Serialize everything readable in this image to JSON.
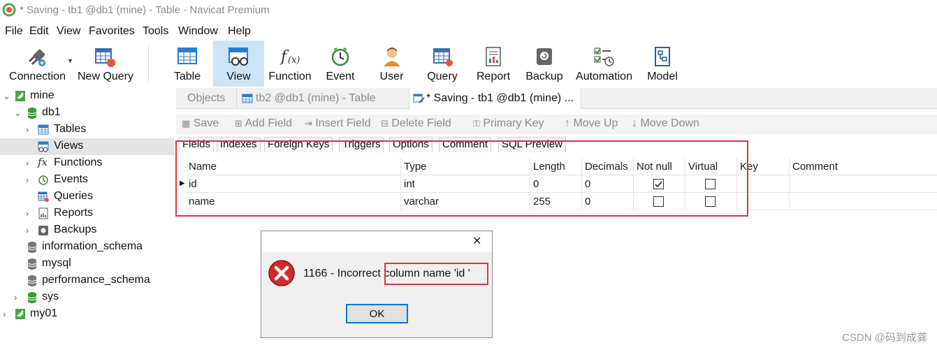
{
  "window": {
    "title": "* Saving - tb1 @db1 (mine) - Table - Navicat Premium"
  },
  "menu": [
    "File",
    "Edit",
    "View",
    "Favorites",
    "Tools",
    "Window",
    "Help"
  ],
  "toolbar": {
    "connection": "Connection",
    "new_query": "New Query",
    "table": "Table",
    "view": "View",
    "function": "Function",
    "event": "Event",
    "user": "User",
    "query": "Query",
    "report": "Report",
    "backup": "Backup",
    "automation": "Automation",
    "model": "Model"
  },
  "sidebar": {
    "items": [
      {
        "label": "mine"
      },
      {
        "label": "db1"
      },
      {
        "label": "Tables"
      },
      {
        "label": "Views"
      },
      {
        "label": "Functions"
      },
      {
        "label": "Events"
      },
      {
        "label": "Queries"
      },
      {
        "label": "Reports"
      },
      {
        "label": "Backups"
      },
      {
        "label": "information_schema"
      },
      {
        "label": "mysql"
      },
      {
        "label": "performance_schema"
      },
      {
        "label": "sys"
      },
      {
        "label": "my01"
      }
    ]
  },
  "tabs": [
    {
      "label": "Objects"
    },
    {
      "label": "tb2 @db1 (mine) - Table"
    },
    {
      "label": "* Saving - tb1 @db1 (mine) ..."
    }
  ],
  "actions": {
    "save": "Save",
    "add_field": "Add Field",
    "insert_field": "Insert Field",
    "delete_field": "Delete Field",
    "primary_key": "Primary Key",
    "move_up": "Move Up",
    "move_down": "Move Down"
  },
  "subtabs": [
    "Fields",
    "Indexes",
    "Foreign Keys",
    "Triggers",
    "Options",
    "Comment",
    "SQL Preview"
  ],
  "grid": {
    "columns": [
      "Name",
      "Type",
      "Length",
      "Decimals",
      "Not null",
      "Virtual",
      "Key",
      "Comment"
    ],
    "rows": [
      {
        "name": "id",
        "type": "int",
        "length": "0",
        "decimals": "0",
        "not_null": true,
        "virtual": false
      },
      {
        "name": "name",
        "type": "varchar",
        "length": "255",
        "decimals": "0",
        "not_null": false,
        "virtual": false
      }
    ]
  },
  "dialog": {
    "message_prefix": "1166 - Incorrect",
    "message_highlight": "column name 'id  '",
    "ok": "OK",
    "close": "✕"
  },
  "watermark": "CSDN @码到成龚"
}
